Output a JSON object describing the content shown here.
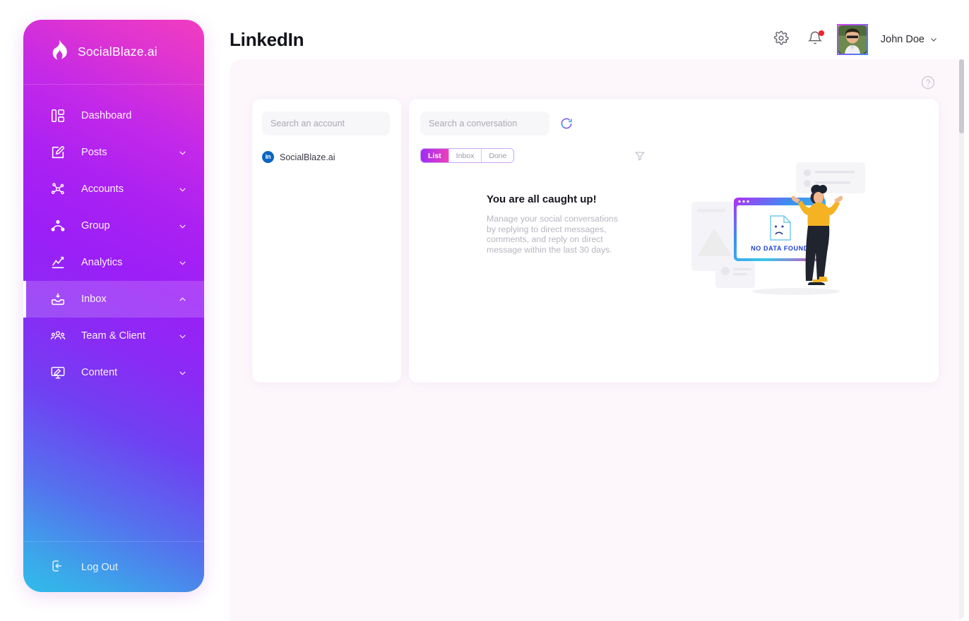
{
  "sidebar": {
    "brand": {
      "name": "SocialBlaze.ai",
      "icon": "flame-icon"
    },
    "items": [
      {
        "label": "Dashboard",
        "icon": "dashboard-icon",
        "expandable": false,
        "active": false
      },
      {
        "label": "Posts",
        "icon": "edit-square-icon",
        "expandable": true,
        "active": false,
        "chevron": "down"
      },
      {
        "label": "Accounts",
        "icon": "network-icon",
        "expandable": true,
        "active": false,
        "chevron": "down"
      },
      {
        "label": "Group",
        "icon": "group-nodes-icon",
        "expandable": true,
        "active": false,
        "chevron": "down"
      },
      {
        "label": "Analytics",
        "icon": "chart-line-icon",
        "expandable": true,
        "active": false,
        "chevron": "down"
      },
      {
        "label": "Inbox",
        "icon": "inbox-icon",
        "expandable": true,
        "active": true,
        "chevron": "up"
      },
      {
        "label": "Team & Client",
        "icon": "people-icon",
        "expandable": true,
        "active": false,
        "chevron": "down"
      },
      {
        "label": "Content",
        "icon": "monitor-edit-icon",
        "expandable": true,
        "active": false,
        "chevron": "down"
      }
    ],
    "logout": {
      "label": "Log Out",
      "icon": "logout-icon"
    }
  },
  "header": {
    "title": "LinkedIn",
    "settings_icon": "gear-icon",
    "notifications_icon": "bell-icon",
    "notification_dot": true,
    "user": {
      "name": "John Doe",
      "chevron": "chevron-down-icon",
      "avatar": "user-avatar"
    }
  },
  "content": {
    "help_icon": "help-circle-icon",
    "accounts_panel": {
      "search": {
        "placeholder": "Search an account",
        "value": "",
        "icon": "search-icon"
      },
      "accounts": [
        {
          "name": "SocialBlaze.ai",
          "network": "in",
          "network_color": "#0a66c2"
        }
      ]
    },
    "conversations_panel": {
      "search": {
        "placeholder": "Search a conversation",
        "value": "",
        "icon": "search-icon"
      },
      "refresh_icon": "refresh-icon",
      "filter_icon": "filter-funnel-icon",
      "tabs": [
        {
          "label": "List",
          "active": true
        },
        {
          "label": "Inbox",
          "active": false
        },
        {
          "label": "Done",
          "active": false
        }
      ],
      "empty_state": {
        "title": "You are all caught up!",
        "description": "Manage your social conversations by replying to direct messages, comments, and reply on direct message within the last 30 days.",
        "illustration_label": "NO DATA FOUND"
      }
    }
  },
  "colors": {
    "sidebar_gradient_start": "#f23cc0",
    "sidebar_gradient_end": "#2fbce8",
    "accent_pink": "#ef3fbb",
    "accent_purple": "#a02cf5",
    "linkedin_blue": "#0a66c2",
    "notification_red": "#f5222d",
    "content_bg": "#fdf7fc"
  }
}
